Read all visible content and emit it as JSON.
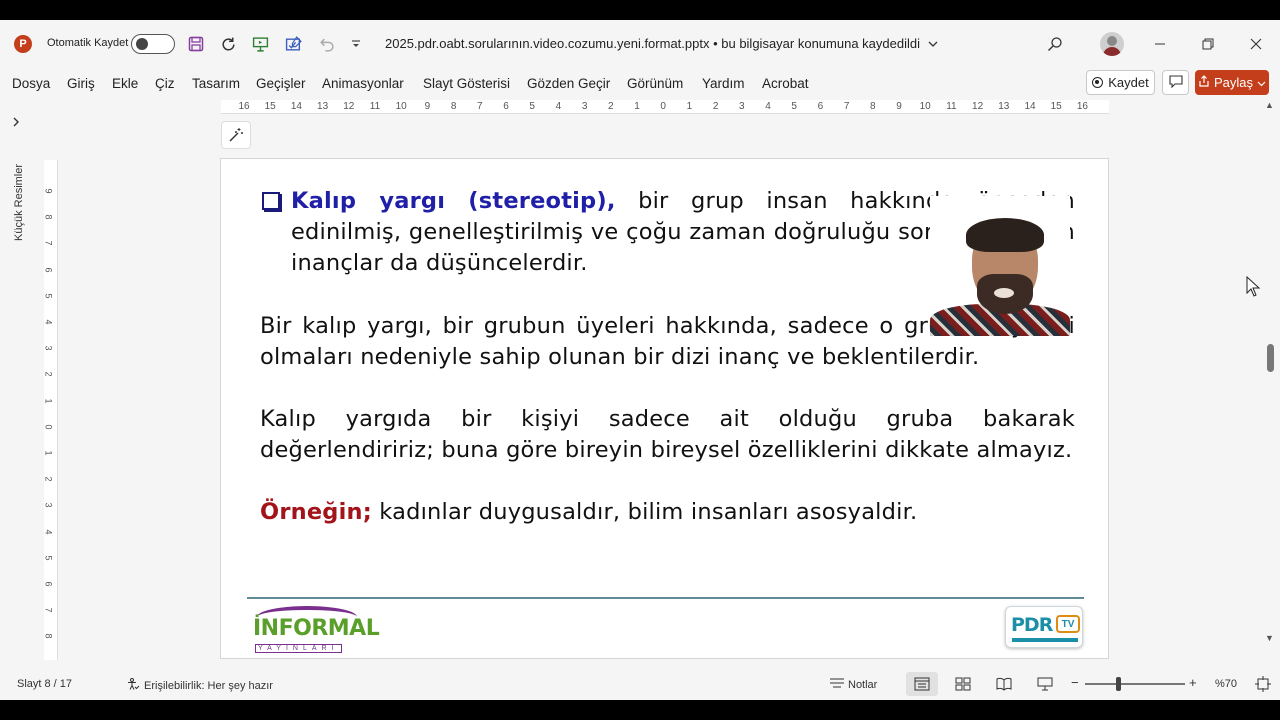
{
  "titlebar": {
    "app_icon": "P",
    "autosave_label": "Otomatik Kaydet",
    "autosave_state": "off",
    "document_title": "2025.pdr.oabt.sorularının.video.cozumu.yeni.format.pptx • bu bilgisayar konumuna kaydedildi",
    "quick_access_icons": [
      "save-icon",
      "undo-redo-circle-icon",
      "present-from-start-icon",
      "pen-check-icon",
      "undo-icon",
      "customize-dropdown-icon"
    ],
    "window_controls": [
      "minimize",
      "restore",
      "close"
    ]
  },
  "menubar": {
    "items": [
      "Dosya",
      "Giriş",
      "Ekle",
      "Çiz",
      "Tasarım",
      "Geçişler",
      "Animasyonlar",
      "Slayt Gösterisi",
      "Gözden Geçir",
      "Görünüm",
      "Yardım",
      "Acrobat"
    ],
    "record_label": "Kaydet",
    "share_label": "Paylaş",
    "accent_color": "#c43e1c"
  },
  "thumbnail_panel": {
    "label": "Küçük Resimler"
  },
  "ruler": {
    "horizontal": [
      "16",
      "15",
      "14",
      "13",
      "12",
      "11",
      "10",
      "9",
      "8",
      "7",
      "6",
      "5",
      "4",
      "3",
      "2",
      "1",
      "0",
      "1",
      "2",
      "3",
      "4",
      "5",
      "6",
      "7",
      "8",
      "9",
      "10",
      "11",
      "12",
      "13",
      "14",
      "15",
      "16"
    ],
    "vertical": [
      "9",
      "8",
      "7",
      "6",
      "5",
      "4",
      "3",
      "2",
      "1",
      "0",
      "1",
      "2",
      "3",
      "4",
      "5",
      "6",
      "7",
      "8",
      "9"
    ]
  },
  "slide": {
    "p1_highlight": "Kalıp yargı (stereotip),",
    "p1_rest": " bir grup insan hakkında önceden edinilmiş, genelleştirilmiş ve çoğu zaman doğruluğu sorgulanmayan inançlar da düşüncelerdir.",
    "p2": "Bir kalıp yargı, bir grubun üyeleri hakkında, sadece o grubun üyeleri olmaları nedeniyle sahip olunan bir dizi inanç ve beklentilerdir.",
    "p3": "Kalıp yargıda bir kişiyi sadece ait olduğu gruba bakarak değerlendiririz; buna göre bireyin bireysel özelliklerini dikkate almayız.",
    "p4_highlight": "Örneğin;",
    "p4_rest": " kadınlar duygusaldır, bilim insanları asosyaldir.",
    "logo_left_text": "İNFORMAL",
    "logo_left_sub": "YAYINLARI",
    "logo_right_text": "PDR",
    "logo_right_tv": "TV",
    "highlight_blue": "#1f1fa8",
    "highlight_red": "#a3141a"
  },
  "statusbar": {
    "slide_counter": "Slayt 8 / 17",
    "accessibility": "Erişilebilirlik: Her şey hazır",
    "notes_label": "Notlar",
    "zoom_label": "%70",
    "zoom_percent": 70
  }
}
